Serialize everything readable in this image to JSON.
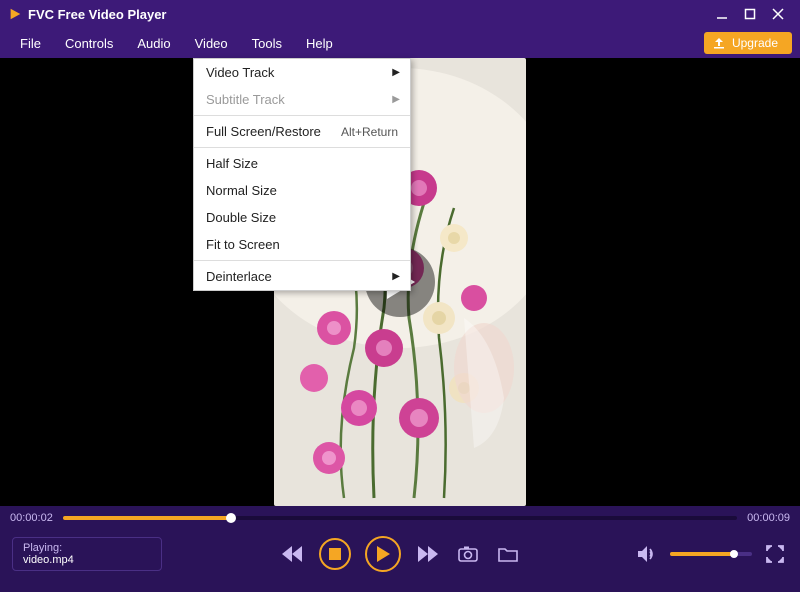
{
  "titlebar": {
    "title": "FVC Free Video Player"
  },
  "menu": {
    "items": [
      "File",
      "Controls",
      "Audio",
      "Video",
      "Tools",
      "Help"
    ],
    "upgrade": "Upgrade"
  },
  "dropdown": {
    "video_track": "Video Track",
    "subtitle_track": "Subtitle Track",
    "full_screen": "Full Screen/Restore",
    "full_screen_shortcut": "Alt+Return",
    "half_size": "Half Size",
    "normal_size": "Normal Size",
    "double_size": "Double Size",
    "fit_to_screen": "Fit to Screen",
    "deinterlace": "Deinterlace"
  },
  "playback": {
    "current_time": "00:00:02",
    "total_time": "00:00:09",
    "progress_pct": 25
  },
  "nowplaying": {
    "label": "Playing:",
    "file": "video.mp4"
  },
  "volume": {
    "pct": 78
  },
  "colors": {
    "accent": "#f5a623",
    "primary": "#3d1a78",
    "bottombar": "#2a1358"
  }
}
